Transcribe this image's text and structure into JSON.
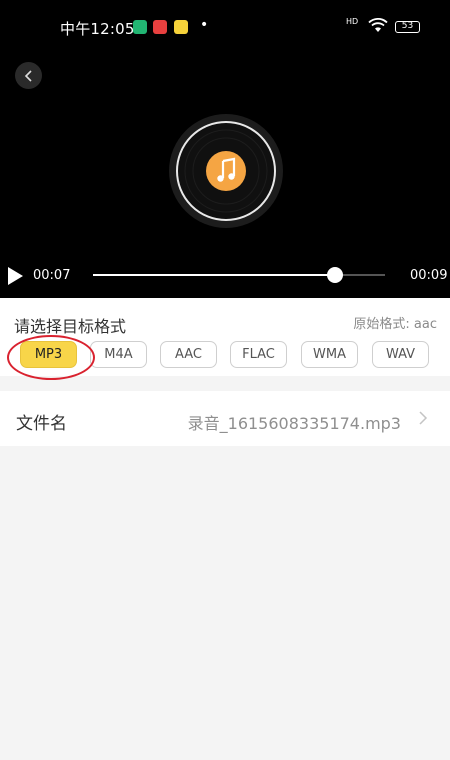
{
  "status_bar": {
    "time": "中午12:05",
    "dot": "•",
    "network_label": "HD",
    "battery": "53"
  },
  "player": {
    "current_time": "00:07",
    "duration": "00:09",
    "progress_fraction": 0.83
  },
  "format_section": {
    "title": "请选择目标格式",
    "original_format": "原始格式: aac",
    "formats": [
      "MP3",
      "M4A",
      "AAC",
      "FLAC",
      "WMA",
      "WAV"
    ],
    "selected": "MP3"
  },
  "file": {
    "label": "文件名",
    "value": "录音_1615608335174.mp3"
  },
  "colors": {
    "accent_yellow": "#f8d549",
    "disc_center": "#f5a543",
    "annotation_red": "#d9222f"
  }
}
